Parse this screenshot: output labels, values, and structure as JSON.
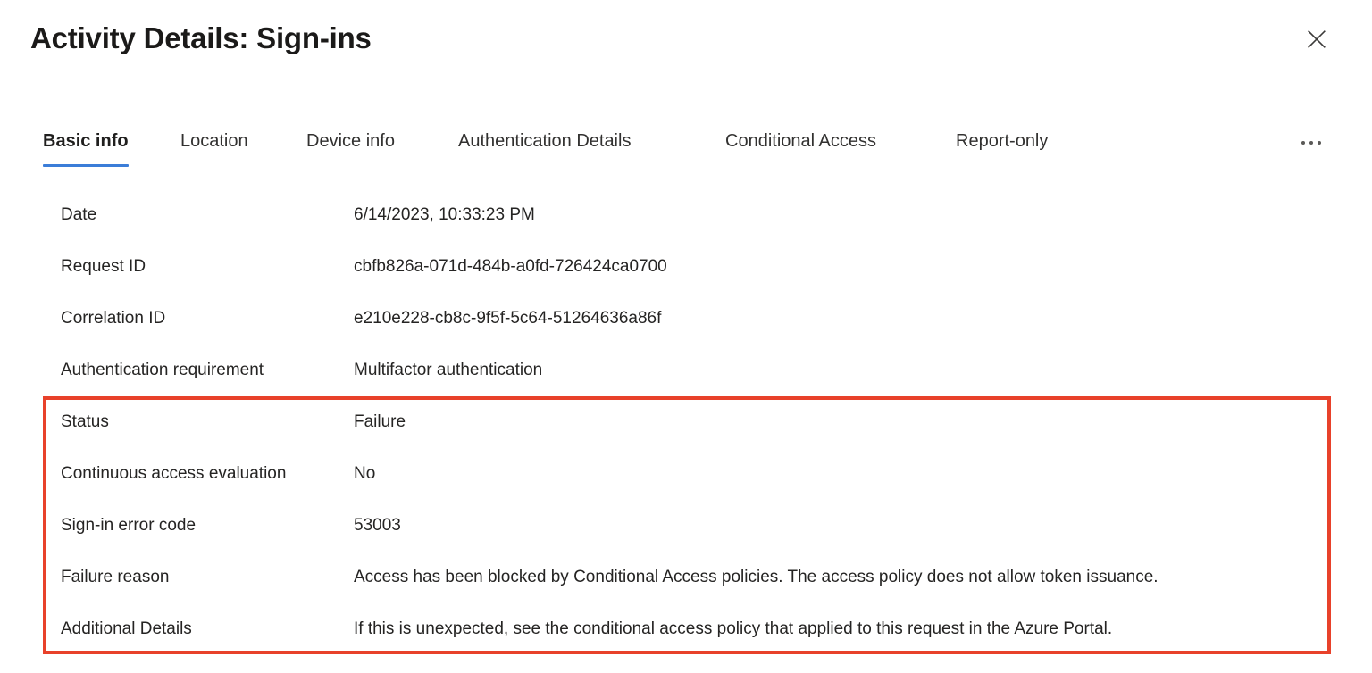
{
  "header": {
    "title": "Activity Details: Sign-ins",
    "close_icon": "close-icon",
    "close_label": "Close"
  },
  "tabs": {
    "overflow_icon": "ellipsis-icon",
    "items": [
      {
        "label": "Basic info",
        "active": true
      },
      {
        "label": "Location",
        "active": false
      },
      {
        "label": "Device info",
        "active": false
      },
      {
        "label": "Authentication Details",
        "active": false
      },
      {
        "label": "Conditional Access",
        "active": false
      },
      {
        "label": "Report-only",
        "active": false
      }
    ]
  },
  "details": {
    "rows": [
      {
        "label": "Date",
        "value": "6/14/2023, 10:33:23 PM"
      },
      {
        "label": "Request ID",
        "value": "cbfb826a-071d-484b-a0fd-726424ca0700"
      },
      {
        "label": "Correlation ID",
        "value": "e210e228-cb8c-9f5f-5c64-51264636a86f"
      },
      {
        "label": "Authentication requirement",
        "value": "Multifactor authentication"
      },
      {
        "label": "Status",
        "value": "Failure"
      },
      {
        "label": "Continuous access evaluation",
        "value": "No"
      },
      {
        "label": "Sign-in error code",
        "value": "53003"
      },
      {
        "label": "Failure reason",
        "value": "Access has been blocked by Conditional Access policies. The access policy does not allow token issuance."
      },
      {
        "label": "Additional Details",
        "value": "If this is unexpected, see the conditional access policy that applied to this request in the Azure Portal."
      }
    ]
  },
  "annotation": {
    "color": "#e8412a",
    "highlighted_rows": [
      "Status",
      "Continuous access evaluation",
      "Sign-in error code",
      "Failure reason",
      "Additional Details"
    ]
  },
  "colors": {
    "accent_blue": "#3b7dd8",
    "text_primary": "#252423",
    "text_title": "#1b1a19",
    "annotation_red": "#e8412a",
    "background": "#ffffff"
  }
}
